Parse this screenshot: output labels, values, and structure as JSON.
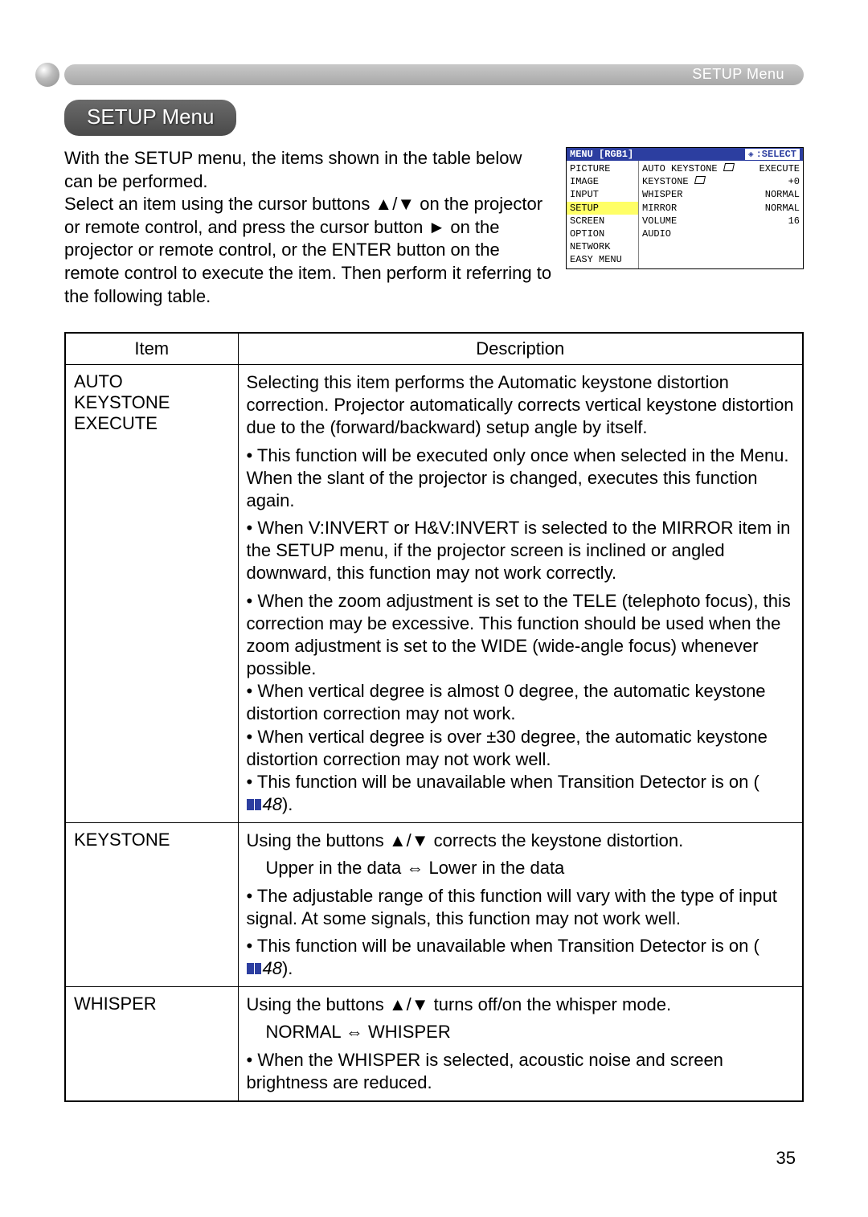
{
  "header": {
    "breadcrumb": "SETUP Menu"
  },
  "section_title": "SETUP Menu",
  "intro": {
    "p1a": "With the SETUP menu, the items shown in the table below can be performed.",
    "p1b": "Select an item using the cursor buttons ▲/▼ on the projector or remote control, and press the cursor button ► on the projector or remote control, or the ENTER button on the remote control to execute the item. Then perform it referring to the following table."
  },
  "osd": {
    "title_left": "MENU [RGB1]",
    "title_right": ":SELECT",
    "left_items": [
      "PICTURE",
      "IMAGE",
      "INPUT",
      "SETUP",
      "SCREEN",
      "OPTION",
      "NETWORK",
      "EASY MENU"
    ],
    "selected_index": 3,
    "right_rows": [
      {
        "label": "AUTO KEYSTONE",
        "icon": "keystone",
        "value": "EXECUTE"
      },
      {
        "label": "KEYSTONE",
        "icon": "keystone",
        "value": "+0"
      },
      {
        "label": "WHISPER",
        "icon": "",
        "value": "NORMAL"
      },
      {
        "label": "MIRROR",
        "icon": "",
        "value": "NORMAL"
      },
      {
        "label": "VOLUME",
        "icon": "",
        "value": "16"
      },
      {
        "label": "AUDIO",
        "icon": "",
        "value": ""
      }
    ]
  },
  "table": {
    "head_item": "Item",
    "head_desc": "Description",
    "rows": [
      {
        "item_lines": [
          "AUTO",
          "KEYSTONE",
          "EXECUTE"
        ],
        "desc": {
          "p1": "Selecting this item performs the Automatic keystone distortion correction. Projector automatically corrects vertical keystone distortion due to the (forward/backward) setup angle by itself.",
          "p2": "• This function will be executed only once when selected in the Menu. When the slant of the projector is changed, executes this function again.",
          "p3": "• When V:INVERT or H&V:INVERT is selected to the MIRROR item in the SETUP menu, if the projector screen is inclined or angled downward, this function may not work correctly.",
          "p4": "• When the zoom adjustment is set to the TELE (telephoto focus), this correction may be excessive. This function should be used when the zoom adjustment is set to the WIDE (wide-angle focus) whenever possible.",
          "p5": "• When vertical degree is almost 0 degree, the automatic keystone distortion correction may not work.",
          "p6": "• When vertical degree is over ±30 degree, the automatic keystone distortion correction may not work well.",
          "p7_pre": "• This function will be unavailable when Transition Detector is on (",
          "p7_ref": "48",
          "p7_post": ")."
        }
      },
      {
        "item_lines": [
          "KEYSTONE"
        ],
        "desc": {
          "p1": "Using the buttons ▲/▼ corrects the keystone distortion.",
          "p2": "Upper in the data ⇔ Lower in the data",
          "p3": "• The adjustable range of this function will vary with the type of input signal. At some signals, this function may not work well.",
          "p4_pre": "• This function will be unavailable when Transition Detector is on (",
          "p4_ref": "48",
          "p4_post": ")."
        }
      },
      {
        "item_lines": [
          "WHISPER"
        ],
        "desc": {
          "p1": "Using the buttons ▲/▼ turns off/on the whisper mode.",
          "p2": "NORMAL ⇔ WHISPER",
          "p3": "• When the WHISPER is selected, acoustic noise and screen brightness are reduced."
        }
      }
    ]
  },
  "page_number": "35"
}
